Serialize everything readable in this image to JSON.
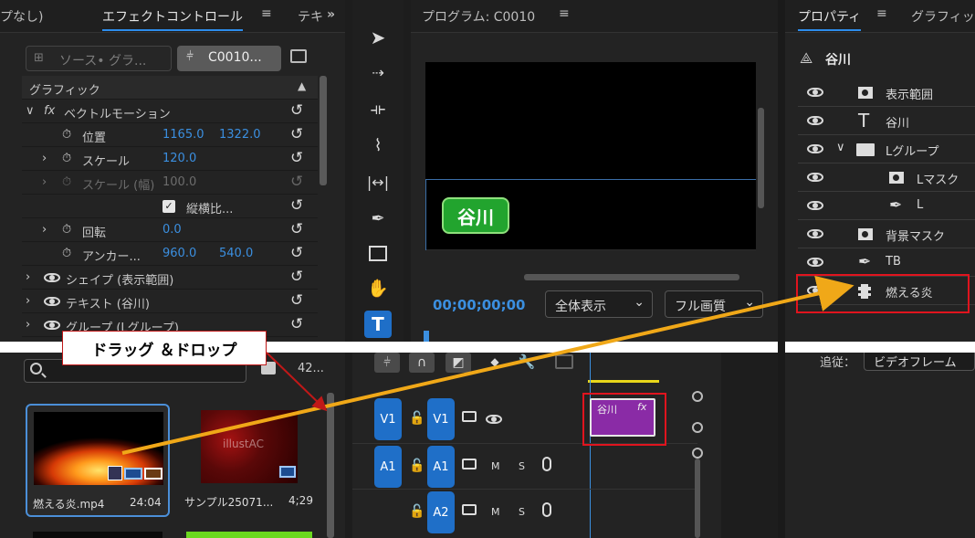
{
  "effect_controls": {
    "tab_prev": "プなし)",
    "tab_active": "エフェクトコントロール",
    "tab_next": "テキ",
    "more": "»",
    "source_button": "ソース• グラ...",
    "clip_button": "C0010...",
    "section": "グラフィック",
    "vector_motion": "ベクトルモーション",
    "position_label": "位置",
    "position_x": "1165.0",
    "position_y": "1322.0",
    "scale_label": "スケール",
    "scale_value": "120.0",
    "scale_width_label": "スケール (幅)",
    "scale_width_value": "100.0",
    "uniform_label": "縦横比...",
    "rotation_label": "回転",
    "rotation_value": "0.0",
    "anchor_label": "アンカー...",
    "anchor_x": "960.0",
    "anchor_y": "540.0",
    "shape_label": "シェイプ (表示範囲)",
    "text_label": "テキスト (谷川)",
    "group_label": "グループ (Lグループ)"
  },
  "program": {
    "title": "プログラム: C0010",
    "overlay_text": "谷川",
    "timecode": "00;00;00;00",
    "fit_select": "全体表示",
    "quality_select": "フル画質"
  },
  "properties": {
    "tab_active": "プロパティ",
    "tab_next": "グラフィッ",
    "header": "谷川",
    "layers": [
      {
        "label": "表示範囲",
        "icon": "mask-icon"
      },
      {
        "label": "谷川",
        "icon": "text-icon"
      },
      {
        "label": "Lグループ",
        "icon": "folder-icon"
      },
      {
        "label": "Lマスク",
        "icon": "mask-icon"
      },
      {
        "label": "L",
        "icon": "pen-icon"
      },
      {
        "label": "背景マスク",
        "icon": "mask-icon"
      },
      {
        "label": "TB",
        "icon": "pen-icon"
      },
      {
        "label": "燃える炎",
        "icon": "film-icon"
      }
    ],
    "follow_label": "追従：",
    "follow_value": "ビデオフレーム"
  },
  "project": {
    "count": "42...",
    "items": [
      {
        "name": "燃える炎.mp4",
        "duration": "24:04"
      },
      {
        "name": "サンプル25071...",
        "duration": "4;29",
        "watermark": "illustAC"
      }
    ]
  },
  "timeline": {
    "tracks": [
      {
        "source": "V1",
        "target": "V1"
      },
      {
        "source": "A1",
        "target": "A1",
        "m": "M",
        "s": "S"
      },
      {
        "source": "",
        "target": "A2",
        "m": "M",
        "s": "S"
      }
    ],
    "clip_label": "谷川",
    "clip_fx": "fx",
    "clip_color": "#8a2ba6"
  },
  "annotation": {
    "callout": "ドラッグ ＆ドロップ",
    "arrow_color": "#f0a818",
    "highlight_color": "#e0141e"
  }
}
